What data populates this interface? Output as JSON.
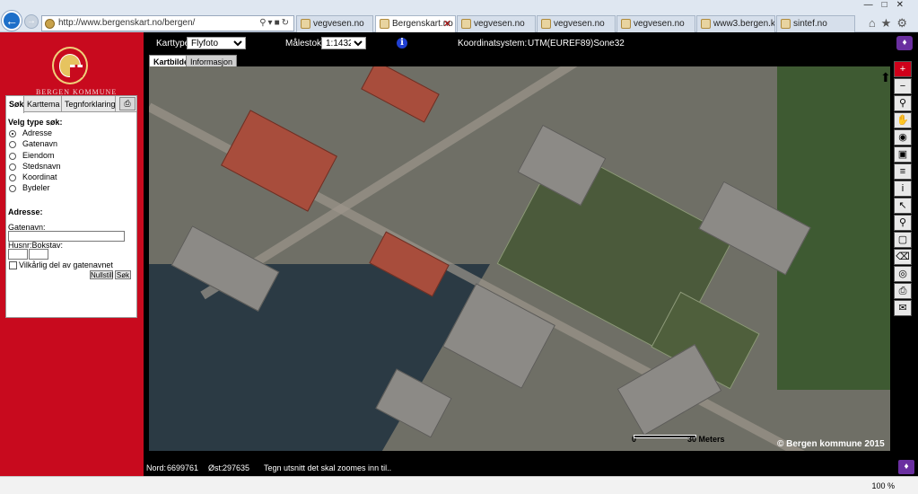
{
  "browser": {
    "url": "http://www.bergenskart.no/bergen/",
    "tabs": [
      "vegvesen.no",
      "Bergenskart.no",
      "vegvesen.no",
      "vegvesen.no",
      "vegvesen.no",
      "www3.bergen.kom...",
      "sintef.no"
    ],
    "zoom": "100 %"
  },
  "header": {
    "kartype_label": "Karttype:",
    "kartype_value": "Flyfoto",
    "malestokk_label": "Målestokk:",
    "malestokk_value": "1:1432",
    "coord_label": "Koordinatsystem:",
    "coord_value": "UTM(EUREF89)Sone32"
  },
  "logo": {
    "text": "BERGEN KOMMUNE"
  },
  "search": {
    "tabs": [
      "Søk",
      "Karttema",
      "Tegnforklaring"
    ],
    "type_heading": "Velg type søk:",
    "options": [
      "Adresse",
      "Gatenavn",
      "Eiendom",
      "Stedsnavn",
      "Koordinat",
      "Bydeler"
    ],
    "selected": "Adresse",
    "adr_heading": "Adresse:",
    "street_label": "Gatenavn:",
    "street_value": "",
    "hus_label": "Husnr:Bokstav:",
    "checkbox_label": "Vilkårlig del av gatenavnet",
    "reset_label": "Nullstill",
    "search_label": "Søk"
  },
  "map": {
    "tabs": [
      "Kartbilde",
      "Informasjon"
    ],
    "scale_start": "0",
    "scale_end": "30 Meters",
    "copyright": "© Bergen kommune 2015"
  },
  "status": {
    "nord_label": "Nord:",
    "nord_value": "6699761",
    "ost_label": "Øst:",
    "ost_value": "297635",
    "message": "Tegn utsnitt det skal zoomes inn til.."
  }
}
